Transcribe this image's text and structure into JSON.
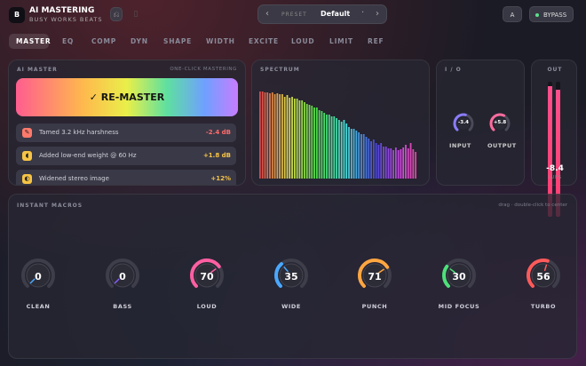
{
  "header": {
    "logo": "B",
    "title": "AI MASTERING",
    "subtitle": "BUSY WORKS BEATS",
    "undo_icon": "undo-icon",
    "preset_label": "PRESET",
    "preset_value": "Default",
    "prev": "‹",
    "next": "›",
    "dot": "·",
    "ab": "A",
    "bypass": "BYPASS"
  },
  "tabs": [
    "MASTER",
    "EQ",
    "COMP",
    "DYN",
    "SHAPE",
    "WIDTH",
    "EXCITE",
    "LOUD",
    "LIMIT",
    "REF"
  ],
  "ai": {
    "title": "AI MASTER",
    "hint": "ONE-CLICK MASTERING",
    "button": "✓ RE-MASTER",
    "items": [
      {
        "text": "Tamed 3.2 kHz harshness",
        "value": "-2.4 dB",
        "color": "#ff6b6b",
        "icon_color": "#ff7a6b"
      },
      {
        "text": "Added low-end weight @ 60 Hz",
        "value": "+1.8 dB",
        "color": "#f6c445",
        "icon_color": "#f6c445"
      },
      {
        "text": "Widened stereo image",
        "value": "+12%",
        "color": "#f6c445",
        "icon_color": "#f6c445"
      }
    ]
  },
  "spectrum": {
    "title": "SPECTRUM"
  },
  "io": {
    "title": "I / O",
    "input_label": "INPUT",
    "input_value": "-3.4",
    "input_level": 0.55,
    "output_label": "OUTPUT",
    "output_value": "+5.8",
    "output_level": 0.6
  },
  "out": {
    "title": "OUT",
    "value": "-8.4",
    "unit": "LUFS",
    "left_level": 0.97,
    "right_level": 0.94
  },
  "macros": {
    "title": "INSTANT MACROS",
    "hint": "drag · double-click to center",
    "knobs": [
      {
        "label": "CLEAN",
        "value": "0",
        "level": 0.0,
        "color": "#4aa8ff"
      },
      {
        "label": "BASS",
        "value": "0",
        "level": 0.0,
        "color": "#8a5cff"
      },
      {
        "label": "LOUD",
        "value": "70",
        "level": 0.7,
        "color": "#ff5fa2"
      },
      {
        "label": "WIDE",
        "value": "35",
        "level": 0.35,
        "color": "#4aa8ff"
      },
      {
        "label": "PUNCH",
        "value": "71",
        "level": 0.71,
        "color": "#ffa640"
      },
      {
        "label": "MID FOCUS",
        "value": "30",
        "level": 0.3,
        "color": "#4ee07a"
      },
      {
        "label": "TURBO",
        "value": "56",
        "level": 0.56,
        "color": "#ff5a5a"
      }
    ]
  }
}
